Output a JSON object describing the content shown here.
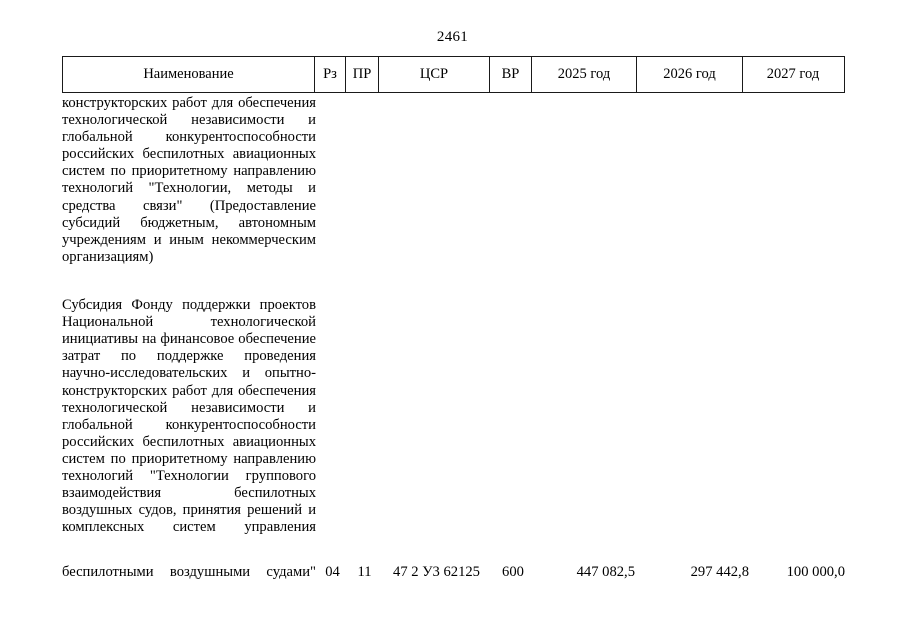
{
  "page": {
    "number": "2461"
  },
  "table": {
    "columns": [
      {
        "key": "name",
        "label": "Наименование"
      },
      {
        "key": "rz",
        "label": "Рз"
      },
      {
        "key": "pr",
        "label": "ПР"
      },
      {
        "key": "csr",
        "label": "ЦСР"
      },
      {
        "key": "vr",
        "label": "ВР"
      },
      {
        "key": "year2025",
        "label": "2025 год"
      },
      {
        "key": "year2026",
        "label": "2026 год"
      },
      {
        "key": "year2027",
        "label": "2027 год"
      }
    ],
    "continued_paragraph": "конструкторских работ для обеспечения технологической независимости и глобальной конкурентоспособности российских беспилотных авиационных систем по приоритетному направлению технологий \"Технологии, методы и средства связи\" (Предоставление субсидий бюджетным, автономным учреждениям и иным некоммерческим организациям)",
    "row": {
      "description_body": "Субсидия Фонду поддержки проектов Национальной технологической инициативы на финансовое обеспечение затрат по поддержке проведения научно-исследовательских и опытно-конструкторских работ для обеспечения технологической независимости и глобальной конкурентоспособности российских беспилотных авиационных систем по приоритетному направлению технологий \"Технологии группового взаимодействия беспилотных воздушных судов, принятия решений и комплексных систем управления",
      "description_last_line": "беспилотными воздушными судами\"",
      "rz": "04",
      "pr": "11",
      "csr": "47 2 У3 62125",
      "vr": "600",
      "year2025": "447 082,5",
      "year2026": "297 442,8",
      "year2027": "100 000,0"
    }
  }
}
